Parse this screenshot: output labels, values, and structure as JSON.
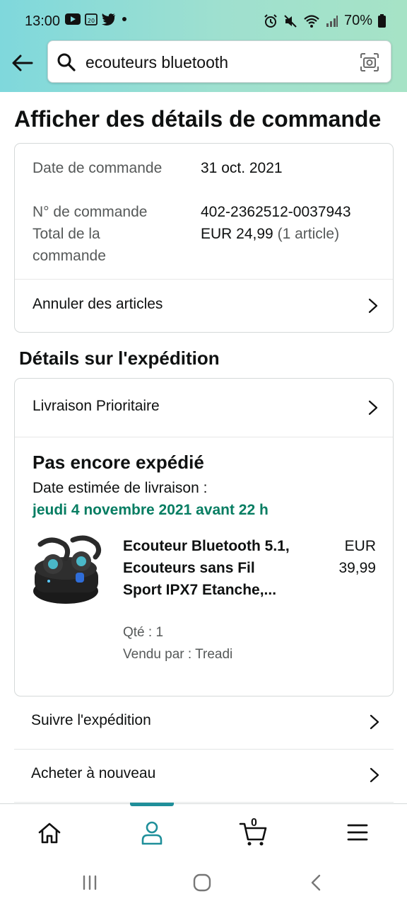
{
  "status_bar": {
    "time": "13:00",
    "battery": "70%",
    "icons_left": [
      "youtube-icon",
      "calendar-icon",
      "twitter-icon",
      "dot-icon"
    ],
    "icons_right": [
      "alarm-icon",
      "mute-icon",
      "wifi-icon",
      "signal-icon",
      "battery-icon"
    ]
  },
  "search": {
    "value": "ecouteurs bluetooth",
    "icons": [
      "back-arrow-icon",
      "search-icon",
      "camera-icon"
    ]
  },
  "page": {
    "title": "Afficher des détails de commande"
  },
  "order_summary": {
    "date_label": "Date de commande",
    "date_value": "31 oct. 2021",
    "number_label": "N° de commande",
    "number_value": "402-2362512-0037943",
    "total_label": "Total de la commande",
    "total_value": "EUR 24,99",
    "total_items": "(1 article)",
    "cancel_link": "Annuler des articles"
  },
  "shipment": {
    "section_title": "Détails sur l'expédition",
    "shipping_method": "Livraison Prioritaire",
    "status": "Pas encore expédié",
    "estimated_label": "Date estimée de livraison :",
    "estimated_date": "jeudi 4 novembre 2021 avant 22 h",
    "product": {
      "name": "Ecouteur Bluetooth 5.1, Ecouteurs sans Fil Sport IPX7 Etanche,...",
      "price_currency": "EUR",
      "price_amount": "39,99",
      "quantity": "Qté : 1",
      "seller": "Vendu par : Treadi"
    }
  },
  "actions": {
    "track": "Suivre l'expédition",
    "buy_again": "Acheter à nouveau"
  },
  "bottom_nav": {
    "items": [
      "home-icon",
      "account-icon",
      "cart-icon",
      "menu-icon"
    ],
    "active": "account-icon",
    "cart_count": "0"
  },
  "colors": {
    "accent": "#1f8f9a",
    "delivery_green": "#067d62",
    "muted_text": "#565959"
  }
}
